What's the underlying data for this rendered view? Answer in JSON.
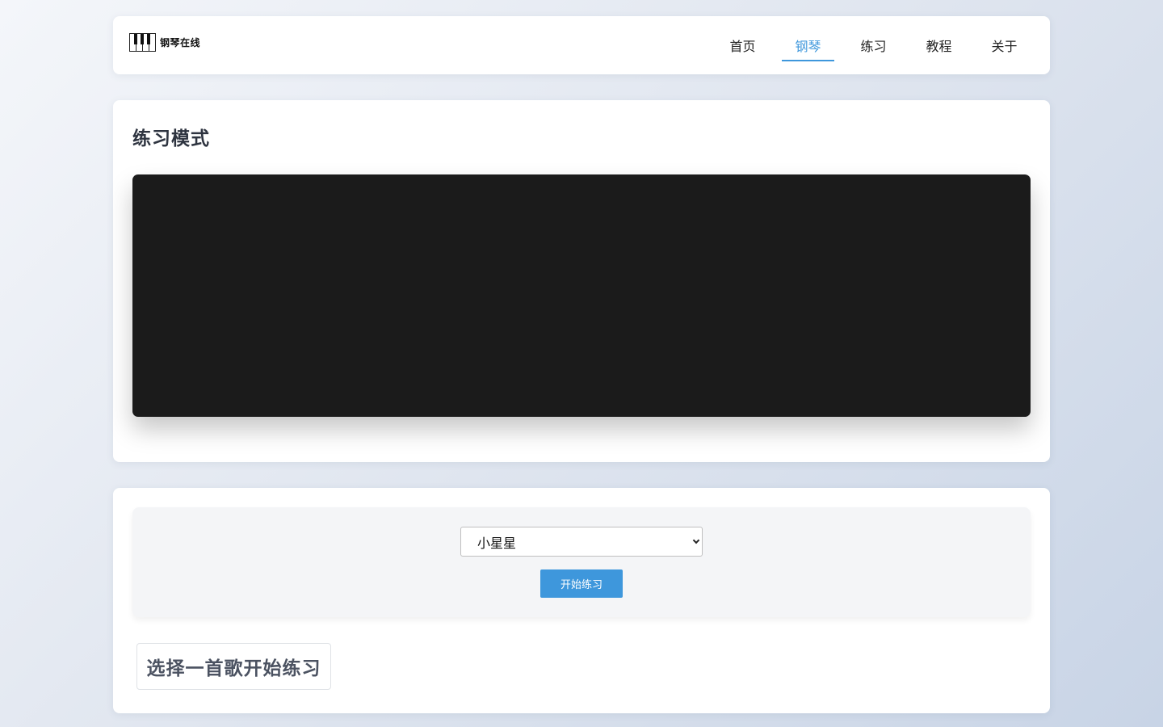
{
  "header": {
    "logo_text": "钢琴在线",
    "nav": [
      {
        "label": "首页",
        "active": false
      },
      {
        "label": "钢琴",
        "active": true
      },
      {
        "label": "练习",
        "active": false
      },
      {
        "label": "教程",
        "active": false
      },
      {
        "label": "关于",
        "active": false
      }
    ]
  },
  "practice": {
    "title": "练习模式"
  },
  "controls": {
    "selected_song": "小星星",
    "start_button": "开始练习",
    "info_text": "选择一首歌开始练习"
  },
  "colors": {
    "accent": "#3e97dc",
    "piano_bg": "#1b1b1b"
  }
}
